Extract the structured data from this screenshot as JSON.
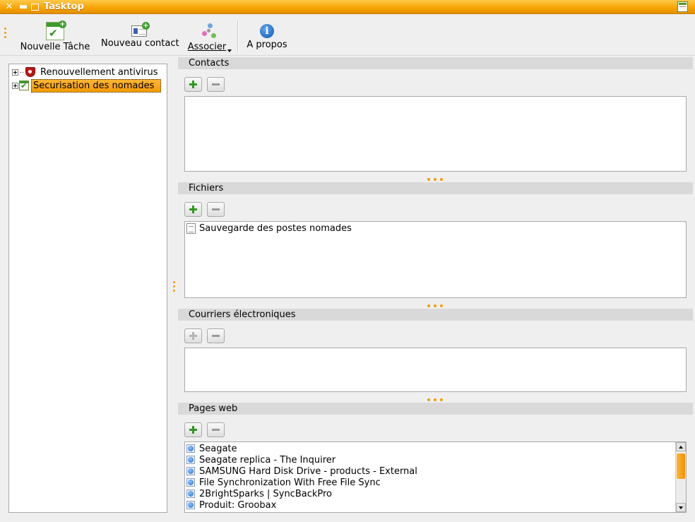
{
  "window": {
    "title": "Tasktop"
  },
  "toolbar": {
    "new_task": "Nouvelle Tâche",
    "new_contact": "Nouveau contact",
    "associate": "Associer",
    "about": "A propos"
  },
  "tree": {
    "items": [
      {
        "label": "Renouvellement antivirus",
        "selected": false
      },
      {
        "label": "Securisation des nomades",
        "selected": true
      }
    ]
  },
  "sections": {
    "contacts": {
      "title": "Contacts",
      "rows": []
    },
    "files": {
      "title": "Fichiers",
      "rows": [
        "Sauvegarde des postes nomades"
      ]
    },
    "emails": {
      "title": "Courriers électroniques",
      "rows": []
    },
    "web": {
      "title": "Pages web",
      "rows": [
        "Seagate",
        "Seagate replica - The Inquirer",
        "SAMSUNG Hard Disk Drive - products - External",
        "File Synchronization With Free File Sync",
        "2BrightSparks | SyncBackPro",
        "Produit: Groobax"
      ]
    }
  },
  "colors": {
    "accent": "#f49a00",
    "header": "#d9d9d9",
    "add": "#2d9a1d"
  }
}
